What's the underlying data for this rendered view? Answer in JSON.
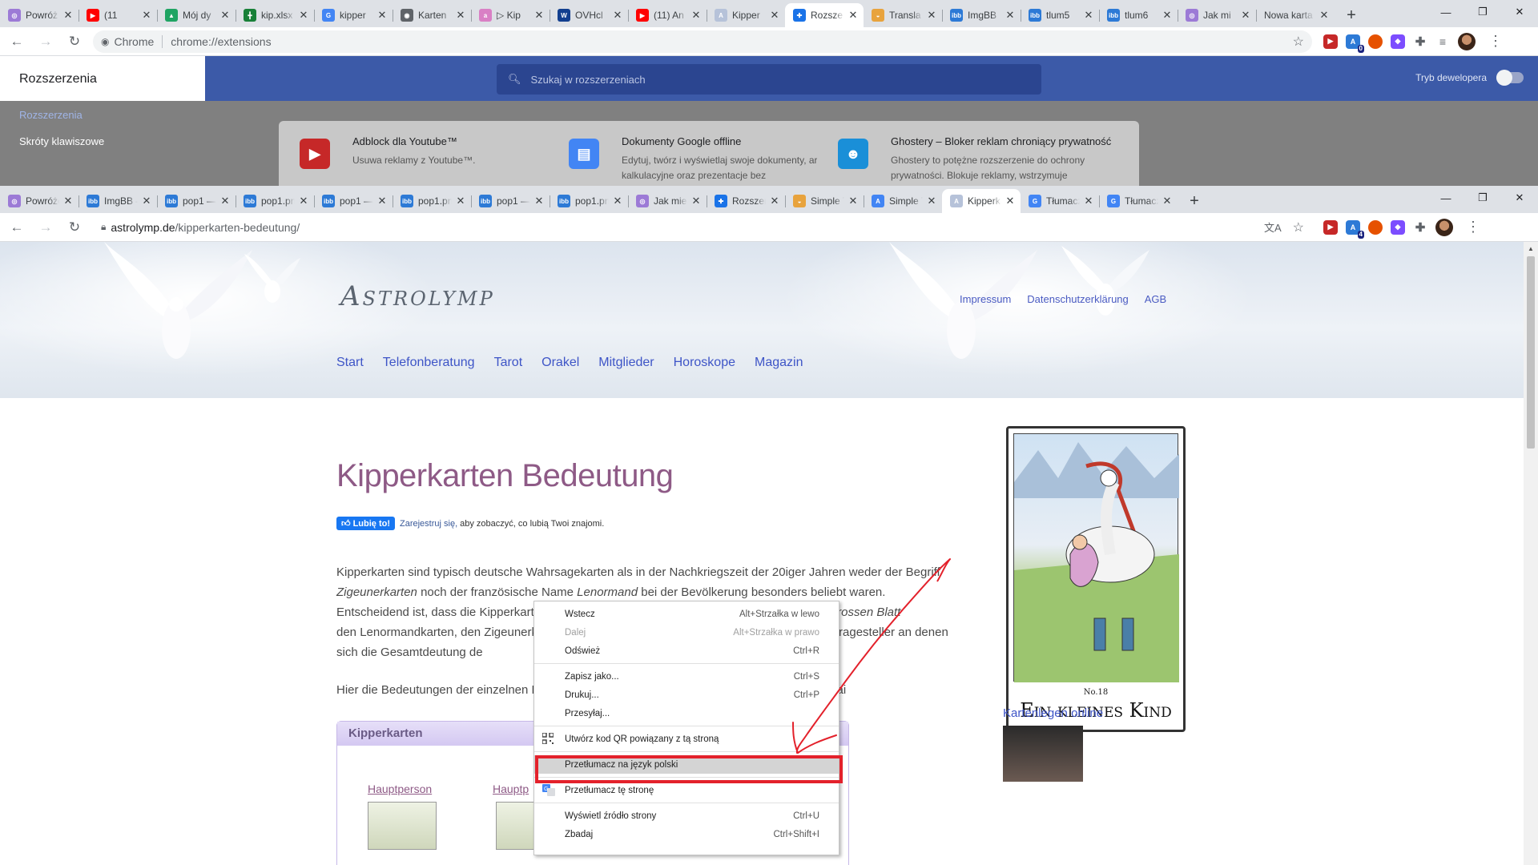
{
  "ext_window": {
    "tabs": [
      {
        "title": "Powróż",
        "color": "#9c7ad6",
        "glyph": "◎"
      },
      {
        "title": "(11",
        "color": "#ff0000",
        "glyph": "▶"
      },
      {
        "title": "Mój dy",
        "color": "#1fa463",
        "glyph": "▲"
      },
      {
        "title": "kip.xlsx",
        "color": "#188038",
        "glyph": "╋"
      },
      {
        "title": "kipper",
        "color": "#4285f4",
        "glyph": "G"
      },
      {
        "title": "Karten",
        "color": "#5f6368",
        "glyph": "◉"
      },
      {
        "title": "▷ Kip",
        "color": "#d980c5",
        "glyph": "a"
      },
      {
        "title": "OVHcl",
        "color": "#123f8f",
        "glyph": "W"
      },
      {
        "title": "(11) An",
        "color": "#ff0000",
        "glyph": "▶"
      },
      {
        "title": "Kipper",
        "color": "#b6c2d9",
        "glyph": "A"
      },
      {
        "title": "Rozsze",
        "color": "#1a73e8",
        "glyph": "✚",
        "active": true
      },
      {
        "title": "Transla",
        "color": "#e8a33d",
        "glyph": "◒"
      },
      {
        "title": "ImgBB",
        "color": "#2d7ad6",
        "glyph": "ibb"
      },
      {
        "title": "tlum5",
        "color": "#2d7ad6",
        "glyph": "ibb"
      },
      {
        "title": "tlum6",
        "color": "#2d7ad6",
        "glyph": "ibb"
      },
      {
        "title": "Jak mi",
        "color": "#9c7ad6",
        "glyph": "◎"
      },
      {
        "title": "Nowa karta",
        "color": "",
        "glyph": ""
      }
    ],
    "omnibox_chip": "Chrome",
    "url": "chrome://extensions",
    "sidebar_title": "Rozszerzenia",
    "sidebar_items": [
      "Rozszerzenia",
      "Skróty klawiszowe"
    ],
    "search_placeholder": "Szukaj w rozszerzeniach",
    "dev_mode_label": "Tryb dewelopera",
    "cards": [
      {
        "name": "Adblock dla Youtube™",
        "desc": "Usuwa reklamy z Youtube™.",
        "color": "#c62828",
        "glyph": "▶"
      },
      {
        "name": "Dokumenty Google offline",
        "desc": "Edytuj, twórz i wyświetlaj swoje dokumenty, arkusze kalkulacyjne oraz prezentacje bez",
        "color": "#4285f4",
        "glyph": "▤"
      },
      {
        "name": "Ghostery – Bloker reklam chroniący prywatność",
        "desc": "Ghostery to potężne rozszerzenie do ochrony prywatności. Blokuje reklamy, wstrzymuje",
        "color": "#1a8fd8",
        "glyph": "☻"
      }
    ]
  },
  "main_window": {
    "tabs": [
      {
        "title": "Powróże",
        "color": "#9c7ad6",
        "glyph": "◎"
      },
      {
        "title": "ImgBB —",
        "color": "#2d7ad6",
        "glyph": "ibb"
      },
      {
        "title": "pop1 — I",
        "color": "#2d7ad6",
        "glyph": "ibb"
      },
      {
        "title": "pop1.png",
        "color": "#2d7ad6",
        "glyph": "ibb"
      },
      {
        "title": "pop1 —",
        "color": "#2d7ad6",
        "glyph": "ibb"
      },
      {
        "title": "pop1.png",
        "color": "#2d7ad6",
        "glyph": "ibb"
      },
      {
        "title": "pop1 —",
        "color": "#2d7ad6",
        "glyph": "ibb"
      },
      {
        "title": "pop1.png",
        "color": "#2d7ad6",
        "glyph": "ibb"
      },
      {
        "title": "Jak mieć",
        "color": "#9c7ad6",
        "glyph": "◎"
      },
      {
        "title": "Rozszerz",
        "color": "#1a73e8",
        "glyph": "✚"
      },
      {
        "title": "Simple T",
        "color": "#e8a33d",
        "glyph": "◒"
      },
      {
        "title": "Simple T",
        "color": "#4285f4",
        "glyph": "A"
      },
      {
        "title": "Kipperka",
        "color": "#b6c2d9",
        "glyph": "A",
        "active": true
      },
      {
        "title": "Tłumacz",
        "color": "#4285f4",
        "glyph": "G"
      },
      {
        "title": "Tłumacz",
        "color": "#4285f4",
        "glyph": "G"
      }
    ],
    "url_host": "astrolymp.de",
    "url_path": "/kipperkarten-bedeutung/",
    "site": {
      "logo": "Astrolymp",
      "top_links": [
        "Impressum",
        "Datenschutzerklärung",
        "AGB"
      ],
      "nav": [
        "Start",
        "Telefonberatung",
        "Tarot",
        "Orakel",
        "Mitglieder",
        "Horoskope",
        "Magazin"
      ],
      "title": "Kipperkarten Bedeutung",
      "fb_like": "Lubię to!",
      "fb_register": "Zarejestruj się,",
      "fb_text": "aby zobaczyć, co lubią Twoi znajomi.",
      "para1": [
        {
          "t": "Kipperkarten sind typisch deutsche Wahrsagekarten als in der Nachkriegszeit der 20iger Jahren weder der Begriff ",
          "i": false
        },
        {
          "t": "Zigeunerkarten",
          "i": true
        },
        {
          "t": " noch der französische Name ",
          "i": false
        },
        {
          "t": "Lenormand",
          "i": true
        },
        {
          "t": " bei der Bevölkerung besonders beliebt waren. Entscheidend ist, dass die Kipperkarten genau wie d",
          "i": false
        },
        {
          "t": "en und zu einer grossen Tafel oder dem ",
          "i": false
        },
        {
          "t": "grossen Blatt",
          "i": true
        },
        {
          "t": "                                den Lenormandkarten, den Zigeunerkarten und auch den Kip                                 weiblichen Fragesteller an denen sich die Gesamtdeutung de",
          "i": false
        }
      ],
      "para2": "Hier die Bedeutungen der einzelnen K                                          nzt werden. Um die Bedeutung eine Kipperkarte im Datai",
      "box_title": "Kipperkarten",
      "box_links": [
        "Hauptperson",
        "Hauptp"
      ],
      "card_number": "No.18",
      "card_name": "Ein kleines Kind",
      "side_link": "Kartenlegen online"
    },
    "context_menu": [
      {
        "label": "Wstecz",
        "shortcut": "Alt+Strzałka w lewo",
        "disabled": false
      },
      {
        "label": "Dalej",
        "shortcut": "Alt+Strzałka w prawo",
        "disabled": true
      },
      {
        "label": "Odśwież",
        "shortcut": "Ctrl+R",
        "disabled": false
      },
      {
        "sep": true
      },
      {
        "label": "Zapisz jako...",
        "shortcut": "Ctrl+S",
        "disabled": false
      },
      {
        "label": "Drukuj...",
        "shortcut": "Ctrl+P",
        "disabled": false
      },
      {
        "label": "Przesyłaj...",
        "shortcut": "",
        "disabled": false
      },
      {
        "sep": true
      },
      {
        "label": "Utwórz kod QR powiązany z tą stroną",
        "shortcut": "",
        "icon": "qr-code-icon"
      },
      {
        "sep": true
      },
      {
        "label": "Przetłumacz na język polski",
        "shortcut": "",
        "highlighted": true
      },
      {
        "sep": true
      },
      {
        "label": "Przetłumacz tę stronę",
        "shortcut": "",
        "icon": "google-translate-icon"
      },
      {
        "sep": true
      },
      {
        "label": "Wyświetl źródło strony",
        "shortcut": "Ctrl+U",
        "disabled": false
      },
      {
        "label": "Zbadaj",
        "shortcut": "Ctrl+Shift+I",
        "disabled": false
      }
    ]
  },
  "colors": {
    "accent": "#1a73e8",
    "site_title": "#8e5a86",
    "site_nav": "#3e55c7",
    "annotation_red": "#e3212b"
  }
}
